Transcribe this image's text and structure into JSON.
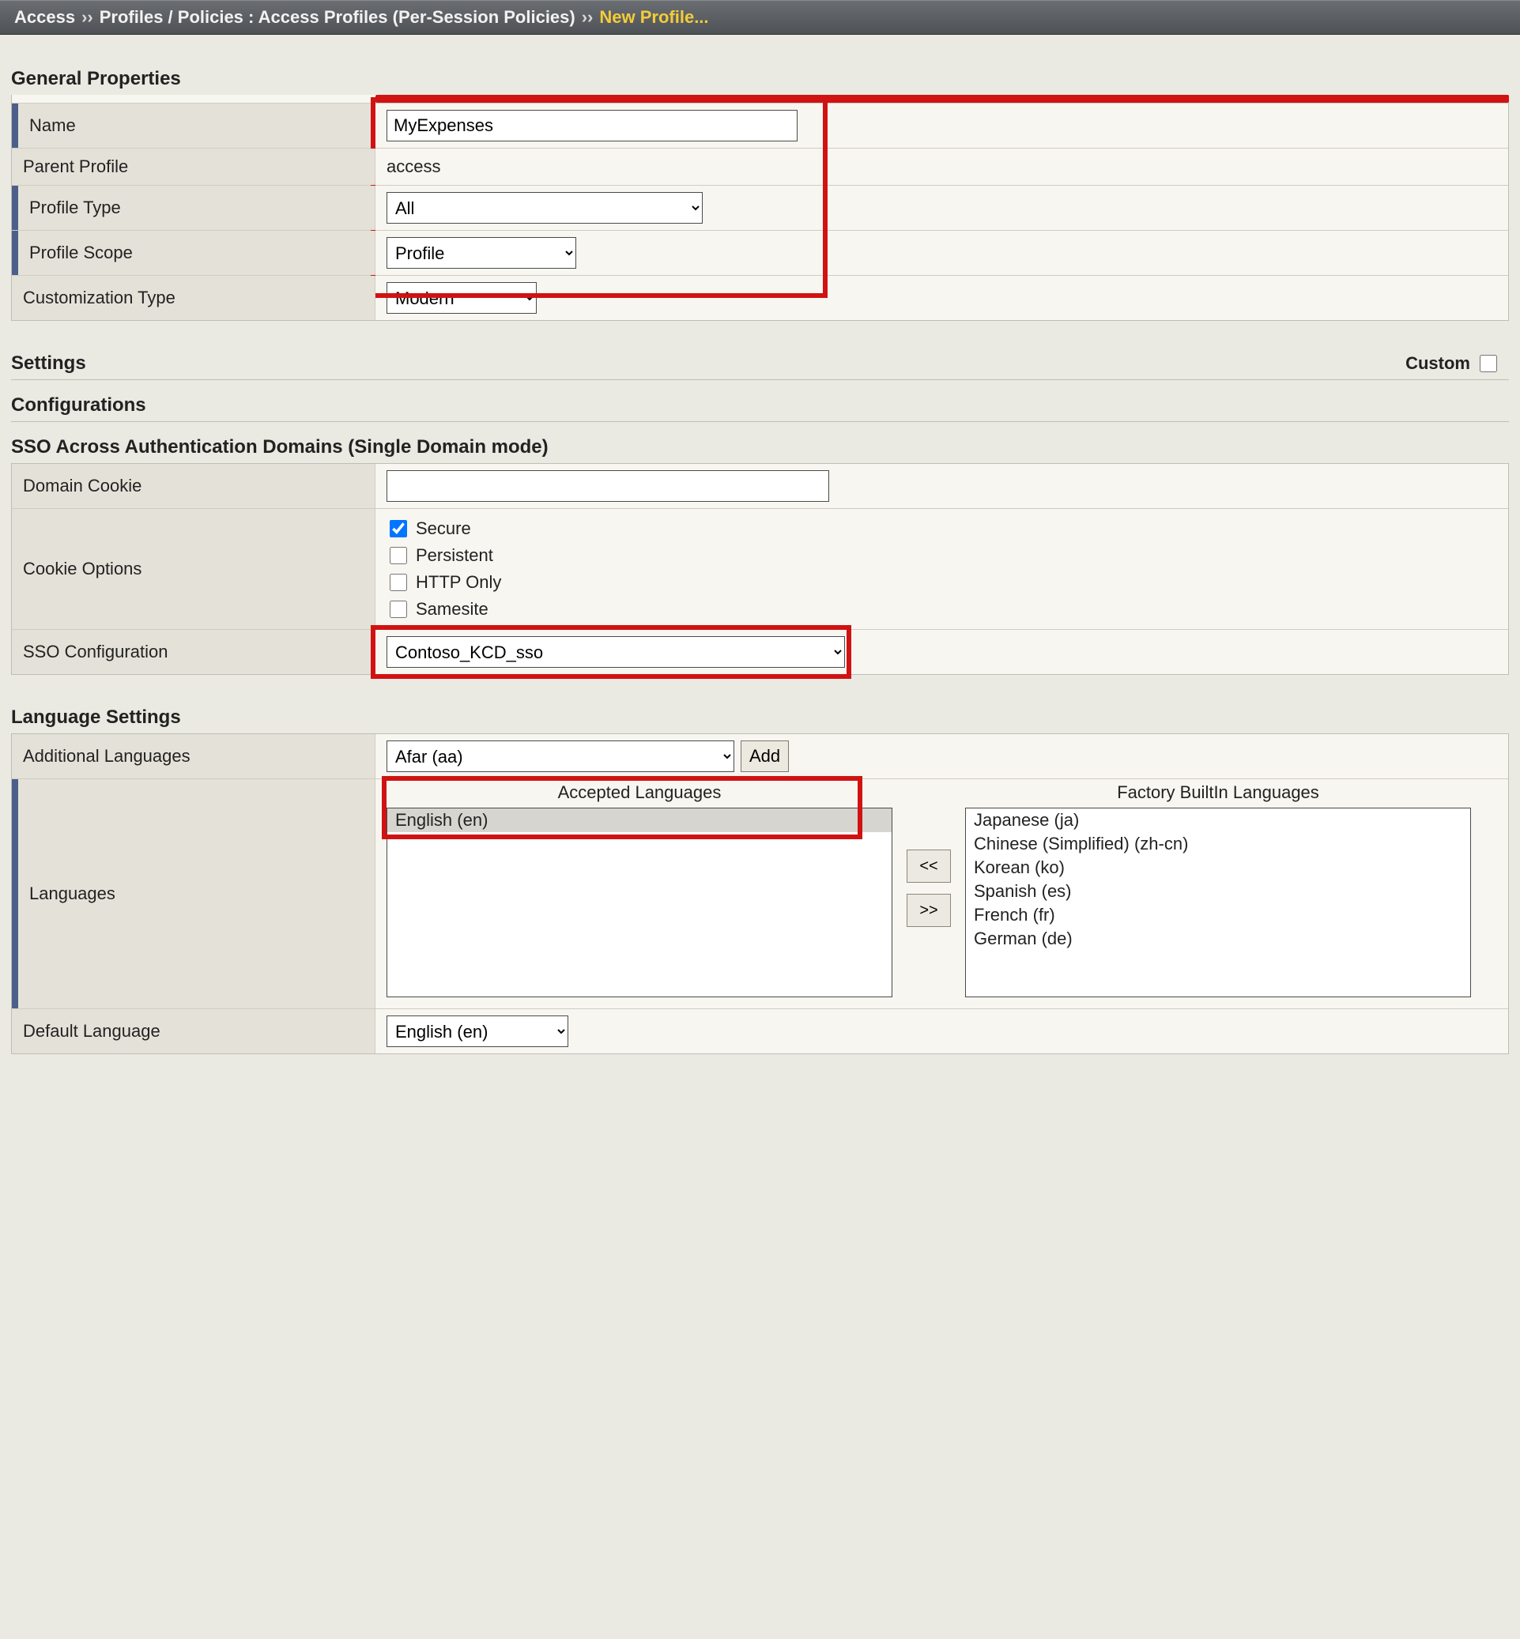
{
  "breadcrumbs": {
    "root": "Access",
    "path": "Profiles / Policies : Access Profiles (Per-Session Policies)",
    "current": "New Profile...",
    "sep": "››"
  },
  "sections": {
    "general": "General Properties",
    "settings": "Settings",
    "custom_label": "Custom",
    "config": "Configurations",
    "sso_domains": "SSO Across Authentication Domains (Single Domain mode)",
    "lang": "Language Settings"
  },
  "general": {
    "name_label": "Name",
    "name_value": "MyExpenses",
    "parent_label": "Parent Profile",
    "parent_value": "access",
    "ptype_label": "Profile Type",
    "ptype_value": "All",
    "scope_label": "Profile Scope",
    "scope_value": "Profile",
    "cust_label": "Customization Type",
    "cust_value": "Modern"
  },
  "sso": {
    "domain_cookie_label": "Domain Cookie",
    "domain_cookie_value": "",
    "cookie_opts_label": "Cookie Options",
    "secure": "Secure",
    "persistent": "Persistent",
    "httponly": "HTTP Only",
    "samesite": "Samesite",
    "sso_conf_label": "SSO Configuration",
    "sso_conf_value": "Contoso_KCD_sso"
  },
  "lang": {
    "addl_label": "Additional Languages",
    "addl_value": "Afar (aa)",
    "add_btn": "Add",
    "langs_label": "Languages",
    "accepted_header": "Accepted Languages",
    "accepted": [
      "English (en)"
    ],
    "factory_header": "Factory BuiltIn Languages",
    "factory": [
      "Japanese (ja)",
      "Chinese (Simplified) (zh-cn)",
      "Korean (ko)",
      "Spanish (es)",
      "French (fr)",
      "German (de)"
    ],
    "move_left": "<<",
    "move_right": ">>",
    "default_label": "Default Language",
    "default_value": "English (en)"
  }
}
